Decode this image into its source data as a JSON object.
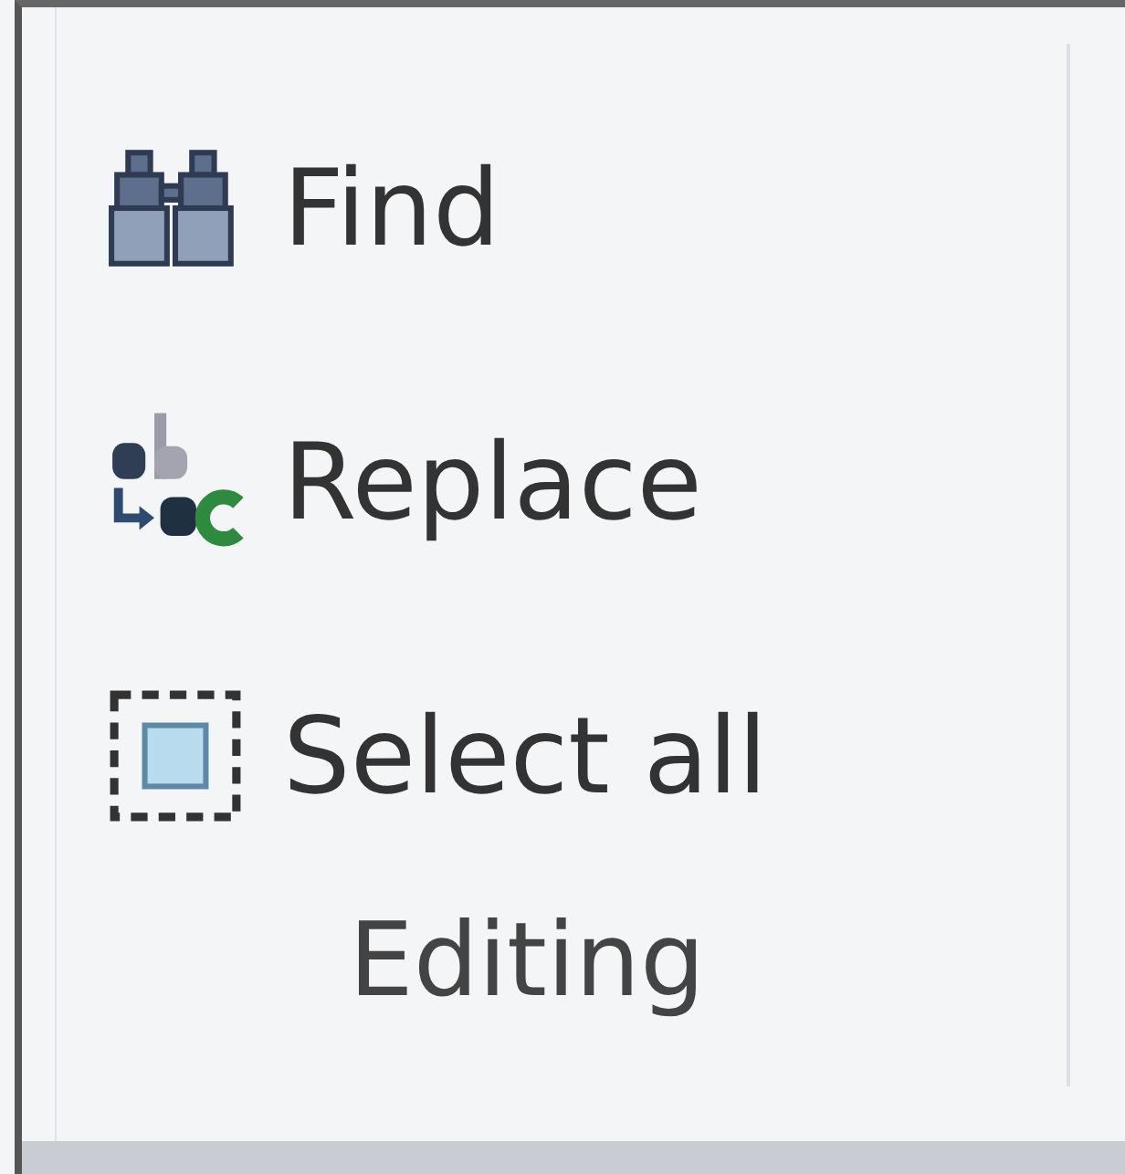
{
  "group": {
    "label": "Editing",
    "items": [
      {
        "kind": "binoculars",
        "label": "Find"
      },
      {
        "kind": "swap",
        "label": "Replace"
      },
      {
        "kind": "marquee",
        "label": "Select all"
      }
    ]
  }
}
